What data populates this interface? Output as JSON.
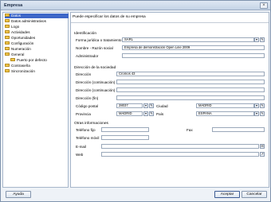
{
  "window": {
    "title": "Empresa",
    "close_glyph": "×"
  },
  "sidebar": {
    "items": [
      {
        "label": "Datos"
      },
      {
        "label": "Datos administrativos"
      },
      {
        "label": "Logo"
      },
      {
        "label": "Actividades"
      },
      {
        "label": "Oportunidades"
      },
      {
        "label": "Configuración"
      },
      {
        "label": "Numeración"
      },
      {
        "label": "General"
      },
      {
        "label": "Puerto por defecto"
      },
      {
        "label": "Contraseña"
      },
      {
        "label": "Sincronización"
      }
    ]
  },
  "main": {
    "header": "Puede especificar los datos de su empresa",
    "identificacion": {
      "title": "Identificación",
      "forma_label": "Forma jurídica o tratamiento",
      "forma_value": "SARL",
      "nombre_label": "Nombre - Razón social",
      "nombre_value": "Empresa de demonstración Open Line 2009",
      "admin_label": "Administrador",
      "admin_value": ""
    },
    "direccion": {
      "title": "Dirección de la sociedad",
      "dir_label": "Dirección",
      "dir_value": "Cromos 43",
      "dir_cont1_label": "Dirección (continuación)",
      "dir_cont2_label": "Dirección (continuación)",
      "dir_fin_label": "Dirección (fin)",
      "cp_label": "Código postal",
      "cp_value": "28037",
      "ciudad_label": "Ciudad",
      "ciudad_value": "MADRID",
      "provincia_label": "Provincia",
      "provincia_value": "MADRID",
      "pais_label": "País",
      "pais_value": "ESPAÑA"
    },
    "otras": {
      "title": "Otras informaciones",
      "tel_fijo_label": "Teléfono fijo",
      "fax_label": "Fax",
      "tel_movil_label": "Teléfono móvil",
      "email_label": "E-mail",
      "web_label": "Web"
    },
    "glyphs": {
      "dropdown": "▾",
      "edit": "✎",
      "email_btn": "✉",
      "web_btn": "↗"
    }
  },
  "footer": {
    "help_label": "Ayuda",
    "accept_label": "Aceptar",
    "cancel_label": "Cancelar"
  },
  "colors": {
    "selected_bg": "#3e67c8",
    "folder": "#f0c54a"
  }
}
